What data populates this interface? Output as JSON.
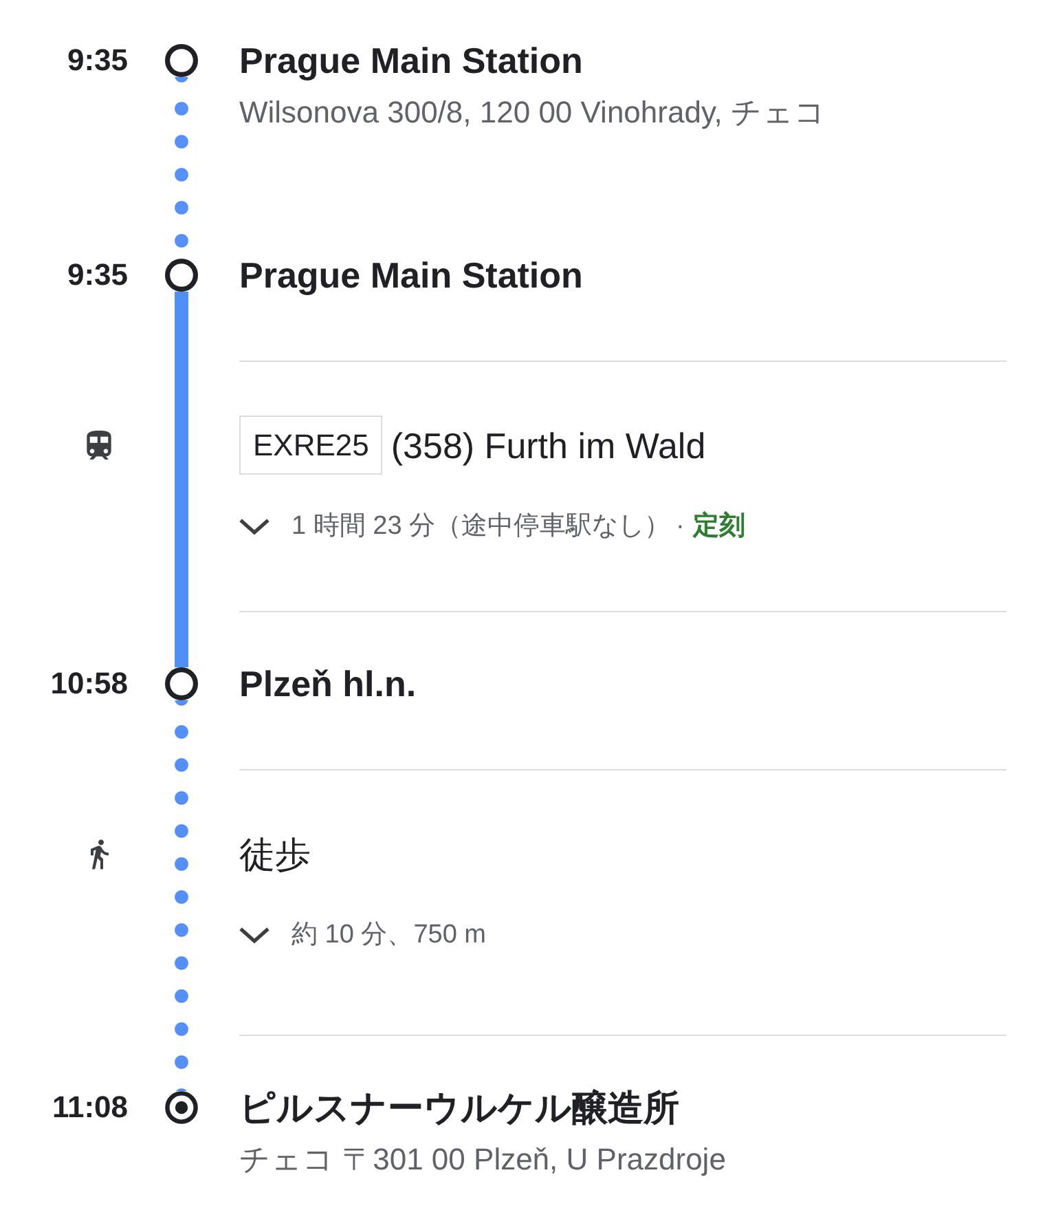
{
  "itinerary": [
    {
      "kind": "stop",
      "time": "9:35",
      "name": "Prague Main Station",
      "address": "Wilsonova 300/8, 120 00 Vinohrady, チェコ"
    },
    {
      "kind": "walk"
    },
    {
      "kind": "stop",
      "time": "9:35",
      "name": "Prague Main Station"
    },
    {
      "kind": "transit",
      "line": "EXRE25",
      "headsign": "(358) Furth im Wald",
      "expanded": false,
      "summary": "1 時間 23 分（途中停車駅なし）",
      "separator": "·",
      "status": {
        "kind": "on_time",
        "label": "定刻"
      }
    },
    {
      "kind": "stop",
      "time": "10:58",
      "name": "Plzeň hl.n."
    },
    {
      "kind": "walk",
      "title": "徒歩",
      "expanded": false,
      "summary": "約 10 分、750 m"
    },
    {
      "kind": "destination",
      "time": "11:08",
      "name": "ピルスナーウルケル醸造所",
      "address": "チェコ 〒301 00 Plzeň, U Prazdroje"
    }
  ]
}
